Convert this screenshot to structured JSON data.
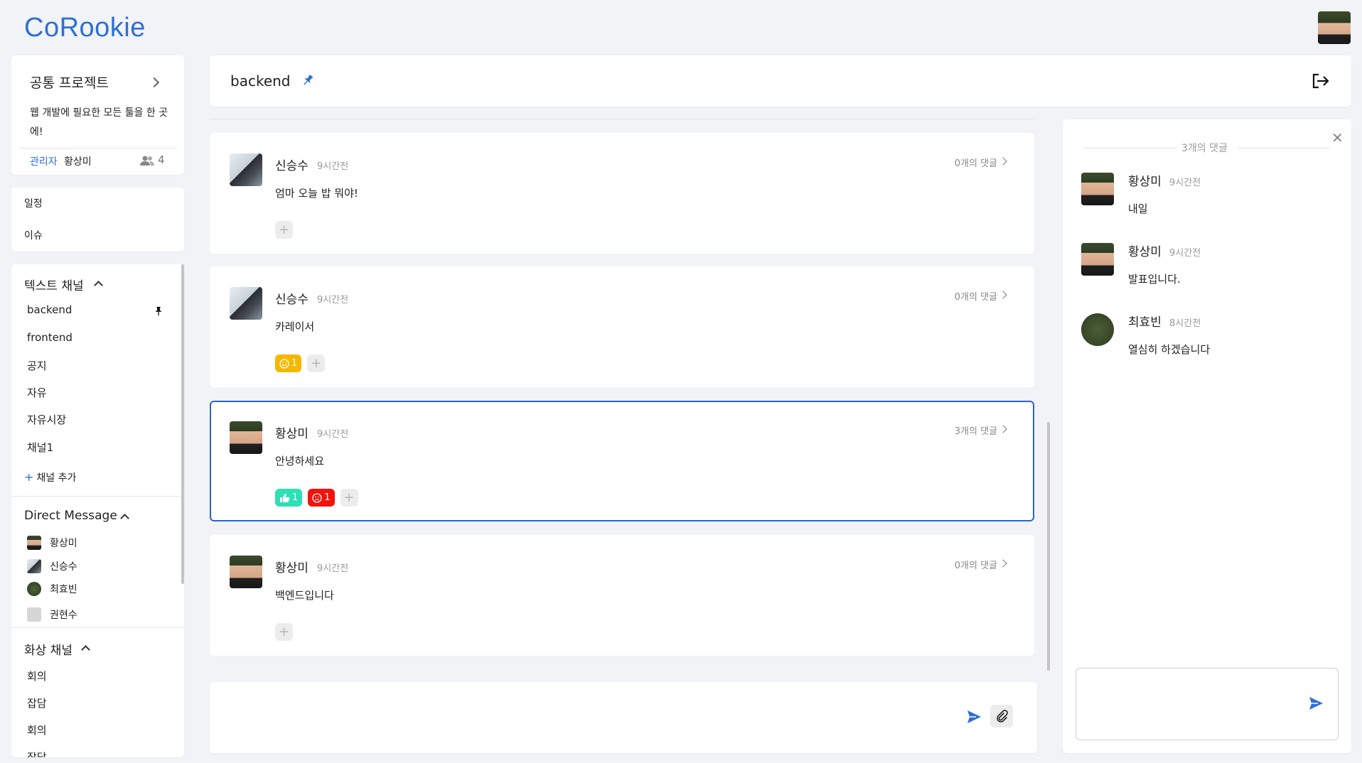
{
  "app": {
    "logo": "CoRookie"
  },
  "project": {
    "title": "공통 프로젝트",
    "description": "웹 개발에 필요한 모든 툴을 한 곳에!",
    "admin_label": "관리자",
    "admin_name": "황상미",
    "member_count": "4"
  },
  "menu": {
    "items": [
      "일정",
      "이슈"
    ]
  },
  "text_channels": {
    "title": "텍스트 채널",
    "items": [
      "backend",
      "frontend",
      "공지",
      "자유",
      "자유시장",
      "채널1"
    ],
    "add_label": "채널 추가"
  },
  "direct_messages": {
    "title": "Direct Message",
    "items": [
      "황상미",
      "신승수",
      "최효빈",
      "권현수"
    ]
  },
  "voice_channels": {
    "title": "화상 채널",
    "items": [
      "회의",
      "잡담",
      "회의",
      "잡담"
    ]
  },
  "header": {
    "channel_name": "backend"
  },
  "messages": [
    {
      "author": "신승수",
      "time": "9시간전",
      "text": "엄마 오늘 밥 뭐야!",
      "comments": "0개의 댓글"
    },
    {
      "author": "신승수",
      "time": "9시간전",
      "text": "카레이서",
      "comments": "0개의 댓글",
      "reaction_count": "1"
    },
    {
      "author": "황상미",
      "time": "9시간전",
      "text": "안녕하세요",
      "comments": "3개의 댓글",
      "reaction_counts": [
        "1",
        "1"
      ]
    },
    {
      "author": "황상미",
      "time": "9시간전",
      "text": "백엔드입니다",
      "comments": "0개의 댓글"
    }
  ],
  "thread": {
    "count_label": "3개의 댓글",
    "comments": [
      {
        "author": "황상미",
        "time": "9시간전",
        "text": "내일"
      },
      {
        "author": "황상미",
        "time": "9시간전",
        "text": "발표입니다."
      },
      {
        "author": "최효빈",
        "time": "8시간전",
        "text": "열심히 하겠습니다"
      }
    ]
  },
  "colors": {
    "accent": "#2e6fd6",
    "active_border": "#2a64c8",
    "react_yellow": "#f5b800",
    "react_green": "#2ee0b5",
    "react_red": "#f0140a"
  }
}
